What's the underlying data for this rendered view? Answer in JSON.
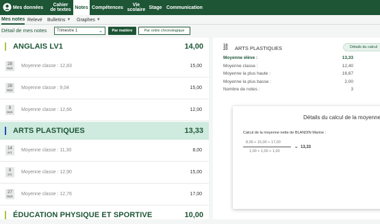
{
  "nav": {
    "items": [
      {
        "label": "Mes données",
        "icon": "profile-icon"
      },
      {
        "label": "Cahier\nde textes"
      },
      {
        "label": "Notes"
      },
      {
        "label": "Compétences"
      },
      {
        "label": "Vie\nscolaire"
      },
      {
        "label": "Stage"
      },
      {
        "label": "Communication"
      }
    ]
  },
  "subnav": {
    "items": [
      {
        "label": "Mes notes"
      },
      {
        "label": "Relevé"
      },
      {
        "label": "Bulletins"
      },
      {
        "label": "Graphes"
      }
    ]
  },
  "filter": {
    "label": "Détail de mes notes",
    "period": "Trimestre 1",
    "by_subject": "Par matière",
    "chronological": "Par ordre chronologique"
  },
  "subjects": [
    {
      "name": "ANGLAIS LV1",
      "average": "14,00"
    },
    {
      "name": "ARTS PLASTIQUES",
      "average": "13,33"
    },
    {
      "name": "ÉDUCATION PHYSIQUE ET SPORTIVE",
      "average": "10,00"
    }
  ],
  "grades": [
    {
      "day": "28",
      "month": "sept.",
      "class_avg": "Moyenne classe : 12,83",
      "grade": "15,00"
    },
    {
      "day": "28",
      "month": "sept.",
      "class_avg": "Moyenne classe : 9,04",
      "grade": "15,00"
    },
    {
      "day": "8",
      "month": "sept.",
      "class_avg": "Moyenne classe : 12,66",
      "grade": "12,00"
    },
    {
      "day": "14",
      "month": "oct.",
      "class_avg": "Moyenne classe : 11,30",
      "grade": "8,00"
    },
    {
      "day": "8",
      "month": "oct.",
      "class_avg": "Moyenne classe : 12,90",
      "grade": "15,00"
    },
    {
      "day": "27",
      "month": "sept.",
      "class_avg": "Moyenne classe : 12,76",
      "grade": "17,00"
    }
  ],
  "right": {
    "icon_top": "16",
    "icon_bottom": "20",
    "title": "ARTS PLASTIQUES",
    "detail_button": "Détails du calcul",
    "stats": [
      {
        "label": "Moyenne élève :",
        "value": "13,33"
      },
      {
        "label": "Moyenne classe :",
        "value": "12,40"
      },
      {
        "label": "Moyenne la plus haute :",
        "value": "16,67"
      },
      {
        "label": "Moyenne la plus basse :",
        "value": "2,00"
      },
      {
        "label": "Nombre de notes :",
        "value": "3"
      }
    ]
  },
  "modal": {
    "title": "Détails du calcul de la moyenne",
    "text": "Calcul de la moyenne nette de BLANDIN Marine :",
    "numerator": "8,00 + 15,00 + 17,00",
    "denominator": "1,00 + 1,00 + 1,00",
    "equals": "=",
    "result": "13,33"
  }
}
